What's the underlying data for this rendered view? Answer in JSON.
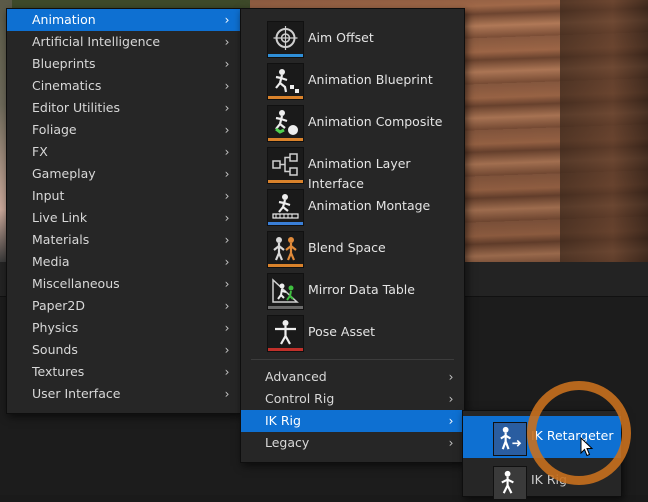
{
  "categories_menu": {
    "items": [
      {
        "label": "Animation",
        "selected": true
      },
      {
        "label": "Artificial Intelligence"
      },
      {
        "label": "Blueprints"
      },
      {
        "label": "Cinematics"
      },
      {
        "label": "Editor Utilities"
      },
      {
        "label": "Foliage"
      },
      {
        "label": "FX"
      },
      {
        "label": "Gameplay"
      },
      {
        "label": "Input"
      },
      {
        "label": "Live Link"
      },
      {
        "label": "Materials"
      },
      {
        "label": "Media"
      },
      {
        "label": "Miscellaneous"
      },
      {
        "label": "Paper2D"
      },
      {
        "label": "Physics"
      },
      {
        "label": "Sounds"
      },
      {
        "label": "Textures"
      },
      {
        "label": "User Interface"
      }
    ],
    "arrow_glyph": "›"
  },
  "animation_menu": {
    "assets": [
      {
        "label": "Aim Offset",
        "icon": "aim-offset-icon",
        "bar_color": "#2f8fd8"
      },
      {
        "label": "Animation Blueprint",
        "icon": "animation-blueprint-icon",
        "bar_color": "#d9822b"
      },
      {
        "label": "Animation Composite",
        "icon": "animation-composite-icon",
        "bar_color": "#d9822b"
      },
      {
        "label": "Animation Layer Interface",
        "icon": "animation-layer-interface-icon",
        "bar_color": "#d9822b"
      },
      {
        "label": "Animation Montage",
        "icon": "animation-montage-icon",
        "bar_color": "#3a7fd8"
      },
      {
        "label": "Blend Space",
        "icon": "blend-space-icon",
        "bar_color": "#d9822b"
      },
      {
        "label": "Mirror Data Table",
        "icon": "mirror-data-table-icon",
        "bar_color": "#6a6a6a"
      },
      {
        "label": "Pose Asset",
        "icon": "pose-asset-icon",
        "bar_color": "#c0302a"
      }
    ],
    "submenus": [
      {
        "label": "Advanced"
      },
      {
        "label": "Control Rig"
      },
      {
        "label": "IK Rig",
        "selected": true
      },
      {
        "label": "Legacy"
      }
    ]
  },
  "ik_rig_menu": {
    "items": [
      {
        "label": "IK Retargeter",
        "icon": "ik-retargeter-icon",
        "selected": true
      },
      {
        "label": "IK Rig",
        "icon": "ik-rig-icon"
      }
    ]
  },
  "colors": {
    "selection": "#0e70d2",
    "menu_background": "#262626",
    "highlight_ring": "#c8701e"
  }
}
